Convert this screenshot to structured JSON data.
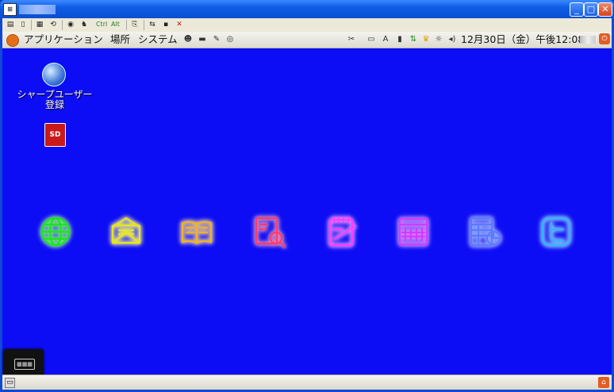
{
  "window": {
    "title_icon": "app-window-icon",
    "buttons": {
      "minimize": "_",
      "maximize": "□",
      "close": "✕"
    }
  },
  "toolbar": {
    "items": [
      {
        "icon": "document-settings-icon",
        "glyph": "▤"
      },
      {
        "icon": "document-icon",
        "glyph": "▯"
      },
      {
        "icon": "grid-icon",
        "glyph": "▦"
      },
      {
        "icon": "refresh-icon",
        "glyph": "⟲"
      },
      {
        "icon": "eye-icon",
        "glyph": "◉"
      },
      {
        "icon": "person-icon",
        "glyph": "♞"
      }
    ],
    "ctrl_label": "Ctrl",
    "alt_label": "Alt",
    "items2": [
      {
        "icon": "copy-icon",
        "glyph": "⎘"
      },
      {
        "icon": "transfer-icon",
        "glyph": "⇆"
      },
      {
        "icon": "save-icon",
        "glyph": "▪"
      },
      {
        "icon": "close-x-icon",
        "glyph": "✕"
      }
    ]
  },
  "panel": {
    "menus": [
      "アプリケーション",
      "場所",
      "システム"
    ],
    "launchers": [
      {
        "icon": "people-icon",
        "glyph": "☻"
      },
      {
        "icon": "terminal-icon",
        "glyph": "▬"
      },
      {
        "icon": "pen-icon",
        "glyph": "✎"
      },
      {
        "icon": "disc-icon",
        "glyph": "◎"
      }
    ],
    "tray": [
      {
        "icon": "tools-icon",
        "glyph": "✂"
      },
      {
        "icon": "monitor-icon",
        "glyph": "▭"
      },
      {
        "icon": "font-icon",
        "glyph": "A"
      },
      {
        "icon": "device-icon",
        "glyph": "▮"
      },
      {
        "icon": "network-icon",
        "glyph": "⇅"
      },
      {
        "icon": "crown-icon",
        "glyph": "♛"
      },
      {
        "icon": "brightness-icon",
        "glyph": "☼"
      },
      {
        "icon": "volume-icon",
        "glyph": "◂)"
      }
    ],
    "clock": "12月30日（金）午後12:08",
    "shutdown_icon": "power-icon"
  },
  "desktop": {
    "icons": [
      {
        "name": "シャープユーザー登録",
        "line1": "シャープユーザー",
        "line2": "登録",
        "icon": "globe-icon"
      },
      {
        "name": "SD",
        "label": "SD",
        "icon": "sd-card-icon"
      }
    ],
    "neon_apps": [
      {
        "icon": "browser-globe-icon",
        "color": "#19e619"
      },
      {
        "icon": "mail-icon",
        "color": "#e6e619"
      },
      {
        "icon": "book-icon",
        "color": "#f2b21f"
      },
      {
        "icon": "dictionary-search-icon",
        "color": "#ff3b6b"
      },
      {
        "icon": "notepad-icon",
        "color": "#ff3bff"
      },
      {
        "icon": "calendar-icon",
        "color": "#d23bff"
      },
      {
        "icon": "spreadsheet-chart-icon",
        "color": "#5a7bff"
      },
      {
        "icon": "twitter-icon",
        "color": "#2fb6ff"
      }
    ]
  },
  "keyboard": {
    "icon": "keyboard-icon"
  },
  "bottom_panel": {
    "left_icon": "show-desktop-icon",
    "right_icon": "trash-icon"
  }
}
